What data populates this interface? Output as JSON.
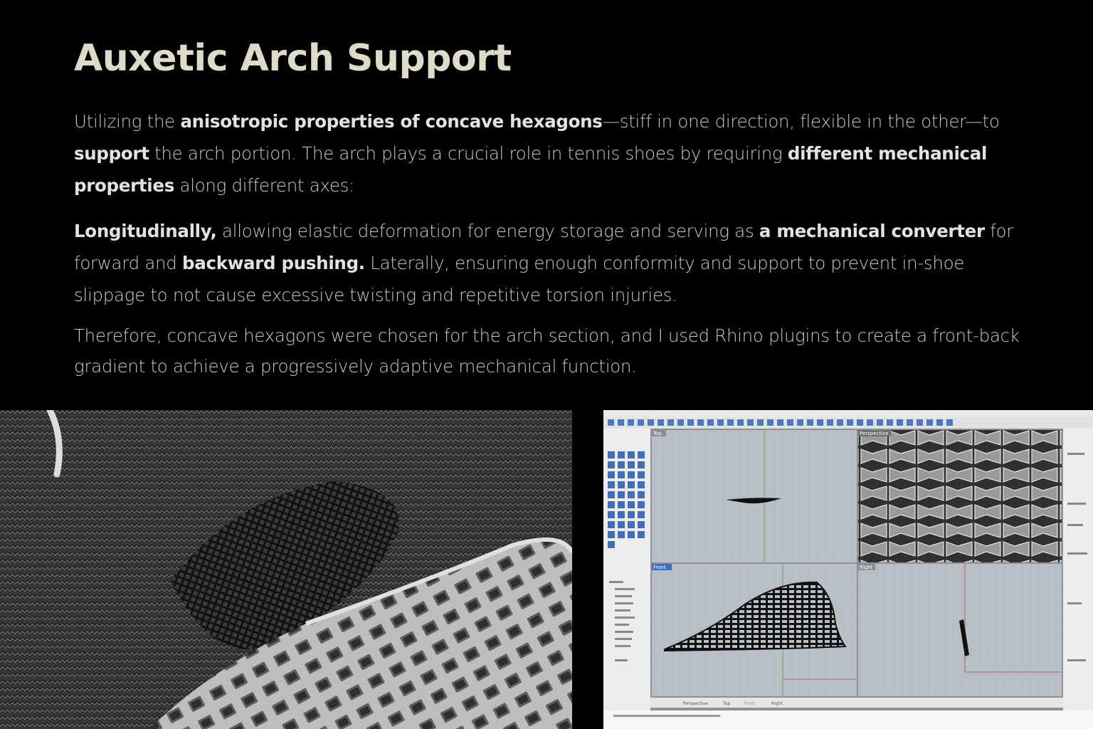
{
  "page": {
    "title": "Auxetic Arch Support",
    "p1": {
      "t1": "Utilizing the ",
      "b1": "anisotropic properties of concave hexagons",
      "t2": "—stiff in one direction, flexible in the other—to ",
      "b2": "support",
      "t3": " the arch portion. The arch plays a crucial role in tennis shoes by requiring ",
      "b3": "different mechanical properties",
      "t4": " along different axes:"
    },
    "p2": {
      "b1": "Longitudinally,",
      "t1": " allowing elastic deformation for energy storage and serving as ",
      "b2": "a mechanical converter",
      "t2": " for forward and ",
      "b3": "backward pushing.",
      "t3": " Laterally, ensuring enough conformity and support to prevent in-shoe slippage to not cause excessive twisting and repetitive torsion injuries."
    },
    "p3": {
      "t1": "Therefore, concave hexagons were chosen for the arch section, and I used Rhino plugins to create a front-back gradient to achieve a progressively adaptive mechanical function."
    }
  },
  "rhino": {
    "viewports": [
      "Top",
      "Perspective",
      "Front",
      "Right"
    ],
    "tabs": [
      "Perspective",
      "Top",
      "Front",
      "Right"
    ]
  }
}
